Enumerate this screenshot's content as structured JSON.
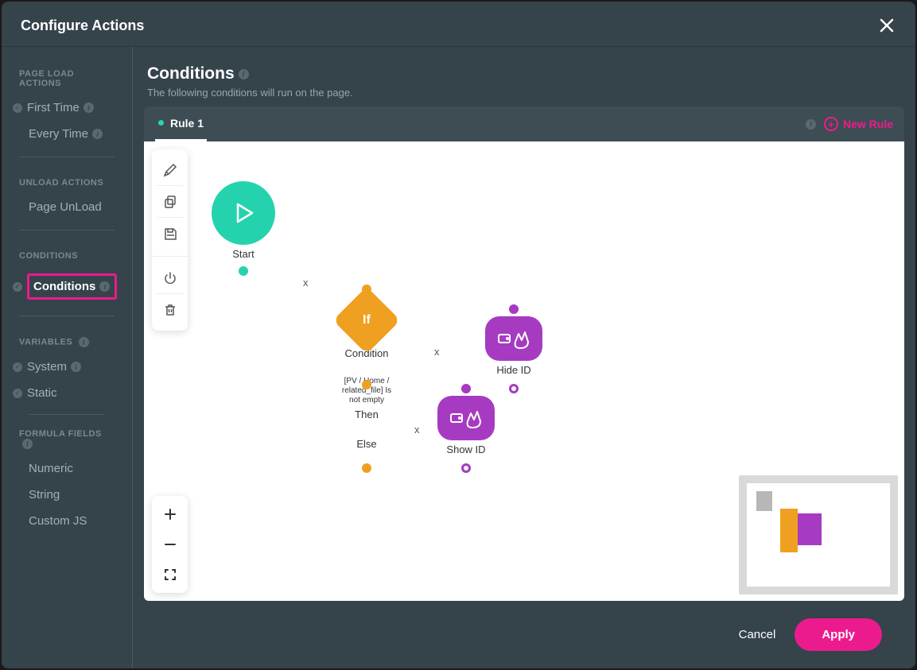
{
  "dialog": {
    "title": "Configure Actions"
  },
  "sidebar": {
    "sections": {
      "page_load": {
        "title": "PAGE LOAD ACTIONS"
      },
      "unload": {
        "title": "UNLOAD ACTIONS"
      },
      "conditions": {
        "title": "CONDITIONS"
      },
      "variables": {
        "title": "VARIABLES"
      },
      "formula": {
        "title": "FORMULA FIELDS"
      }
    },
    "items": {
      "first_time": "First Time",
      "every_time": "Every Time",
      "page_unload": "Page UnLoad",
      "conditions": "Conditions",
      "system": "System",
      "static": "Static",
      "numeric": "Numeric",
      "string": "String",
      "custom_js": "Custom JS"
    }
  },
  "main": {
    "title": "Conditions",
    "subtitle": "The following conditions will run on the page."
  },
  "tabs": {
    "rule1": "Rule 1",
    "new_rule": "New Rule"
  },
  "nodes": {
    "start": "Start",
    "condition": {
      "label": "Condition",
      "if": "If",
      "expr": "[PV / Home / related_file] Is not empty",
      "then": "Then",
      "else": "Else"
    },
    "show_id": "Show ID",
    "hide_id": "Hide ID"
  },
  "footer": {
    "cancel": "Cancel",
    "apply": "Apply"
  },
  "info_glyph": "i",
  "check_glyph": "✓",
  "edge_x": "x"
}
